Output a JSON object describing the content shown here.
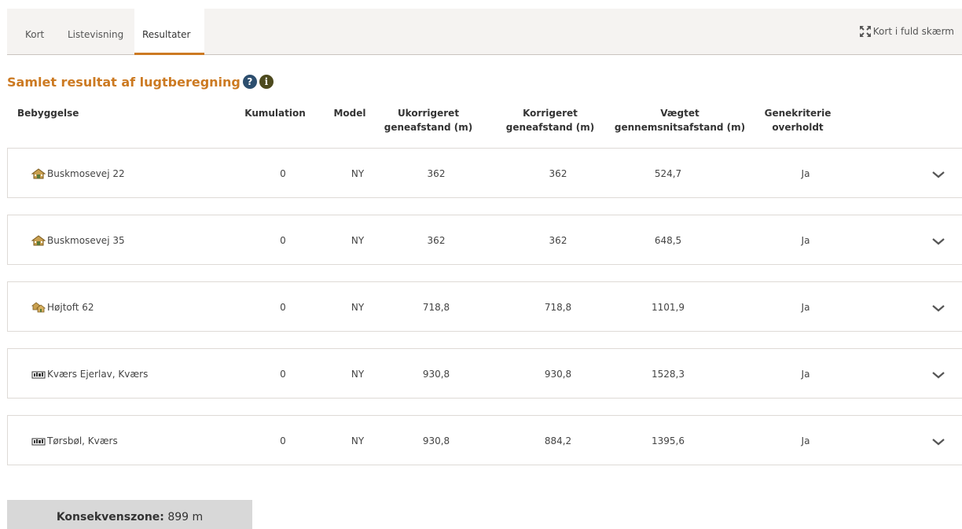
{
  "tabs": {
    "kort": "Kort",
    "liste": "Listevisning",
    "resultater": "Resultater",
    "fullscreen": "Kort i fuld skærm"
  },
  "title": "Samlet resultat af lugtberegning",
  "columns": {
    "bebyggelse": "Bebyggelse",
    "kumulation": "Kumulation",
    "model": "Model",
    "ukorr_1": "Ukorrigeret",
    "ukorr_2": "geneafstand (m)",
    "korr_1": "Korrigeret",
    "korr_2": "geneafstand (m)",
    "vaegt_1": "Vægtet",
    "vaegt_2": "gennemsnitsafstand (m)",
    "gene_1": "Genekriterie",
    "gene_2": "overholdt"
  },
  "rows": [
    {
      "icon": "house-icon",
      "name": "Buskmosevej 22",
      "kumulation": "0",
      "model": "NY",
      "ukorr": "362",
      "korr": "362",
      "vaegt": "524,7",
      "gene": "Ja"
    },
    {
      "icon": "house-icon",
      "name": "Buskmosevej 35",
      "kumulation": "0",
      "model": "NY",
      "ukorr": "362",
      "korr": "362",
      "vaegt": "648,5",
      "gene": "Ja"
    },
    {
      "icon": "houses-icon",
      "name": "Højtoft 62",
      "kumulation": "0",
      "model": "NY",
      "ukorr": "718,8",
      "korr": "718,8",
      "vaegt": "1101,9",
      "gene": "Ja"
    },
    {
      "icon": "town-icon",
      "name": "Kværs Ejerlav, Kværs",
      "kumulation": "0",
      "model": "NY",
      "ukorr": "930,8",
      "korr": "930,8",
      "vaegt": "1528,3",
      "gene": "Ja"
    },
    {
      "icon": "town-icon",
      "name": "Tørsbøl, Kværs",
      "kumulation": "0",
      "model": "NY",
      "ukorr": "930,8",
      "korr": "884,2",
      "vaegt": "1395,6",
      "gene": "Ja"
    }
  ],
  "zone": {
    "label": "Konsekvenszone:",
    "value": "899 m"
  },
  "colors": {
    "accent": "#cc7a22",
    "help_icon": "#2c4e6e",
    "info_icon": "#4d4a1e"
  }
}
